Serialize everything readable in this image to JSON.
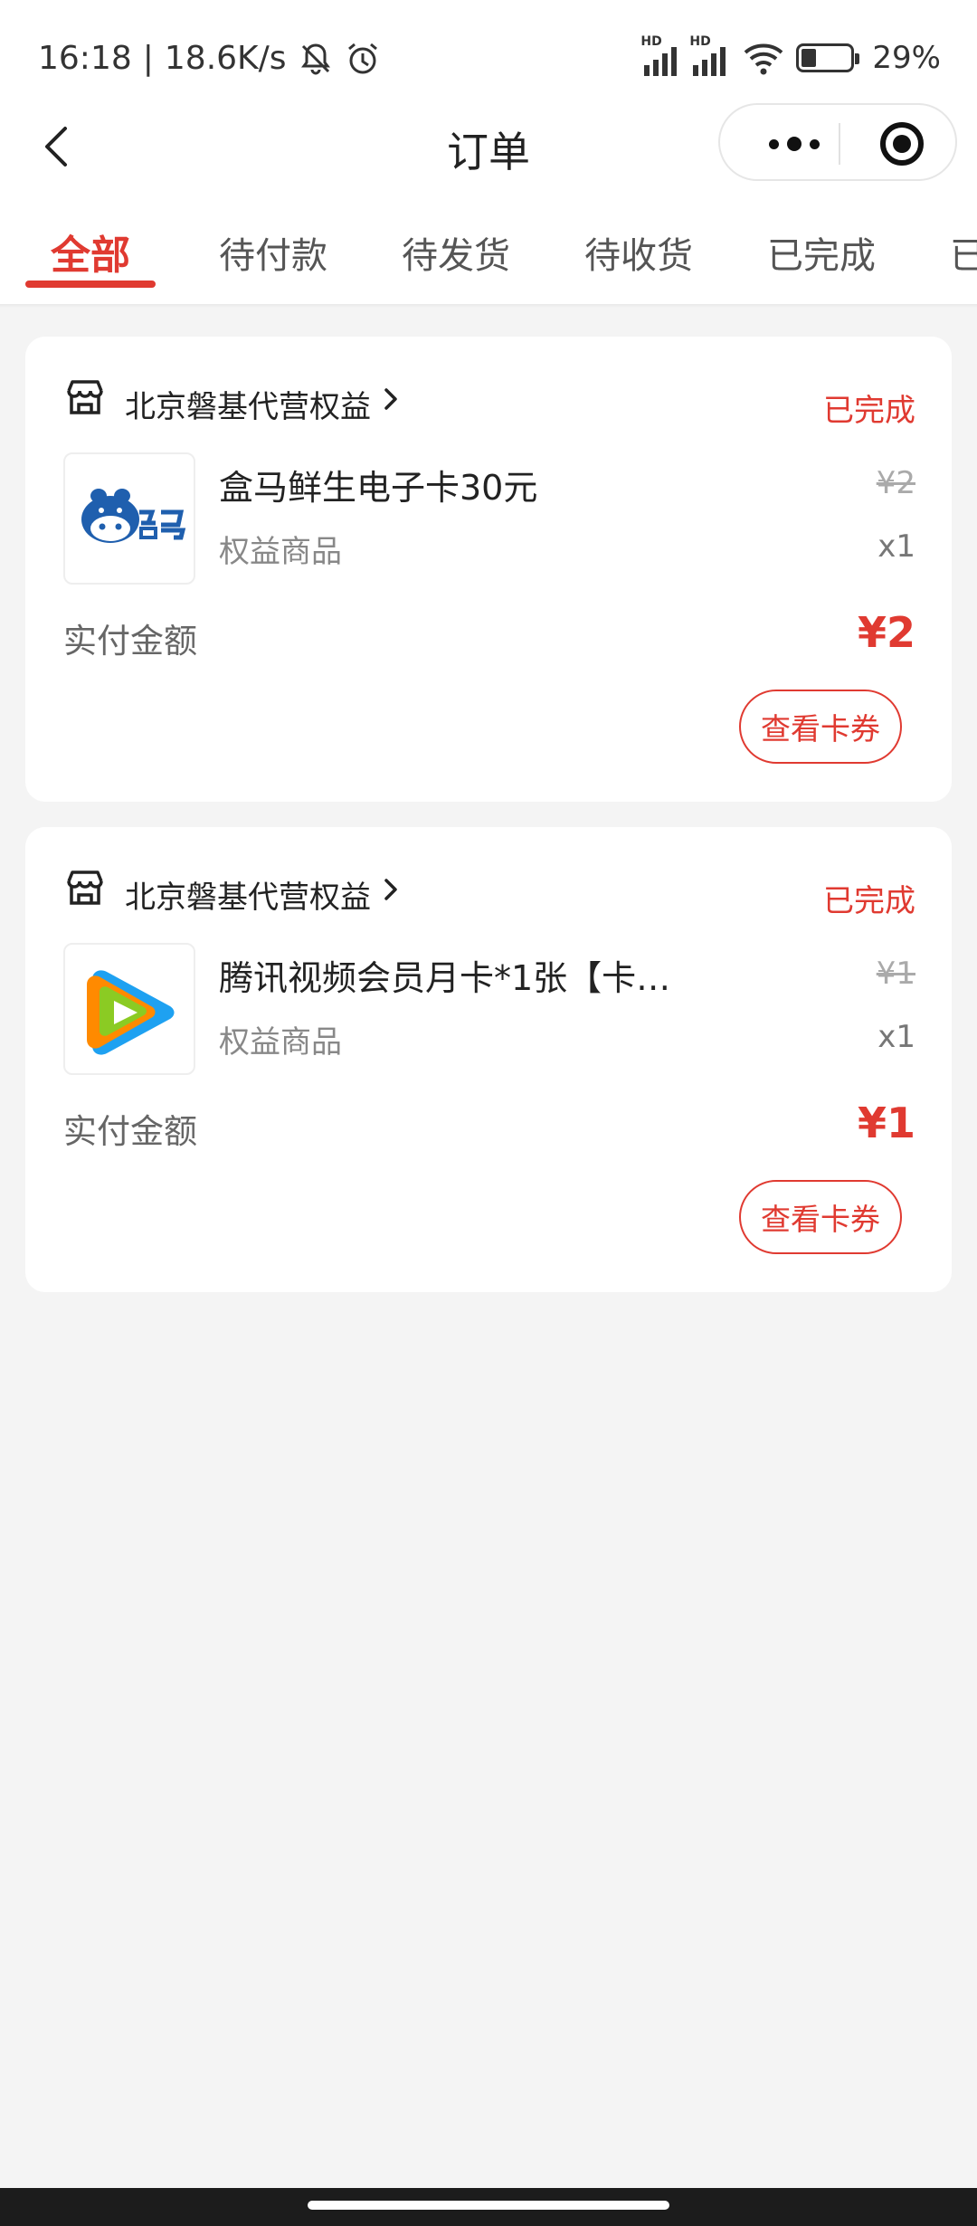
{
  "status_bar": {
    "time": "16:18",
    "separator": "|",
    "speed": "18.6K/s",
    "hd1": "HD",
    "hd2": "HD",
    "battery": "29%"
  },
  "nav": {
    "title": "订单"
  },
  "tabs": [
    {
      "label": "全部",
      "active": true
    },
    {
      "label": "待付款"
    },
    {
      "label": "待发货"
    },
    {
      "label": "待收货"
    },
    {
      "label": "已完成"
    },
    {
      "label": "已"
    }
  ],
  "orders": [
    {
      "shop": "北京磐基代营权益",
      "status": "已完成",
      "product_name": "盒马鲜生电子卡30元",
      "product_type": "权益商品",
      "original_price": "¥2",
      "quantity": "x1",
      "paid_label": "实付金额",
      "paid_amount": "¥2",
      "button": "查看卡券",
      "logo": "hema-logo"
    },
    {
      "shop": "北京磐基代营权益",
      "status": "已完成",
      "product_name": "腾讯视频会员月卡*1张【卡…",
      "product_type": "权益商品",
      "original_price": "¥1",
      "quantity": "x1",
      "paid_label": "实付金额",
      "paid_amount": "¥1",
      "button": "查看卡券",
      "logo": "tencent-video-logo"
    }
  ],
  "colors": {
    "accent": "#e03a31",
    "background": "#f4f4f4"
  }
}
